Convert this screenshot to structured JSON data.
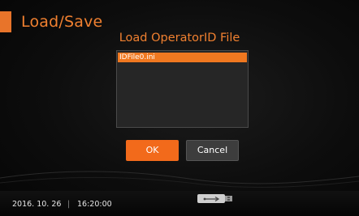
{
  "header": {
    "title": "Load/Save"
  },
  "dialog": {
    "title": "Load OperatorID File",
    "files": [
      "IDFile0.ini"
    ],
    "ok_label": "OK",
    "cancel_label": "Cancel"
  },
  "status": {
    "date": "2016. 10. 26",
    "separator": "|",
    "time": "16:20:00",
    "icon": "usb-drive-icon"
  },
  "colors": {
    "accent": "#f26a1b",
    "title": "#f08030",
    "background": "#0d0d0d"
  }
}
